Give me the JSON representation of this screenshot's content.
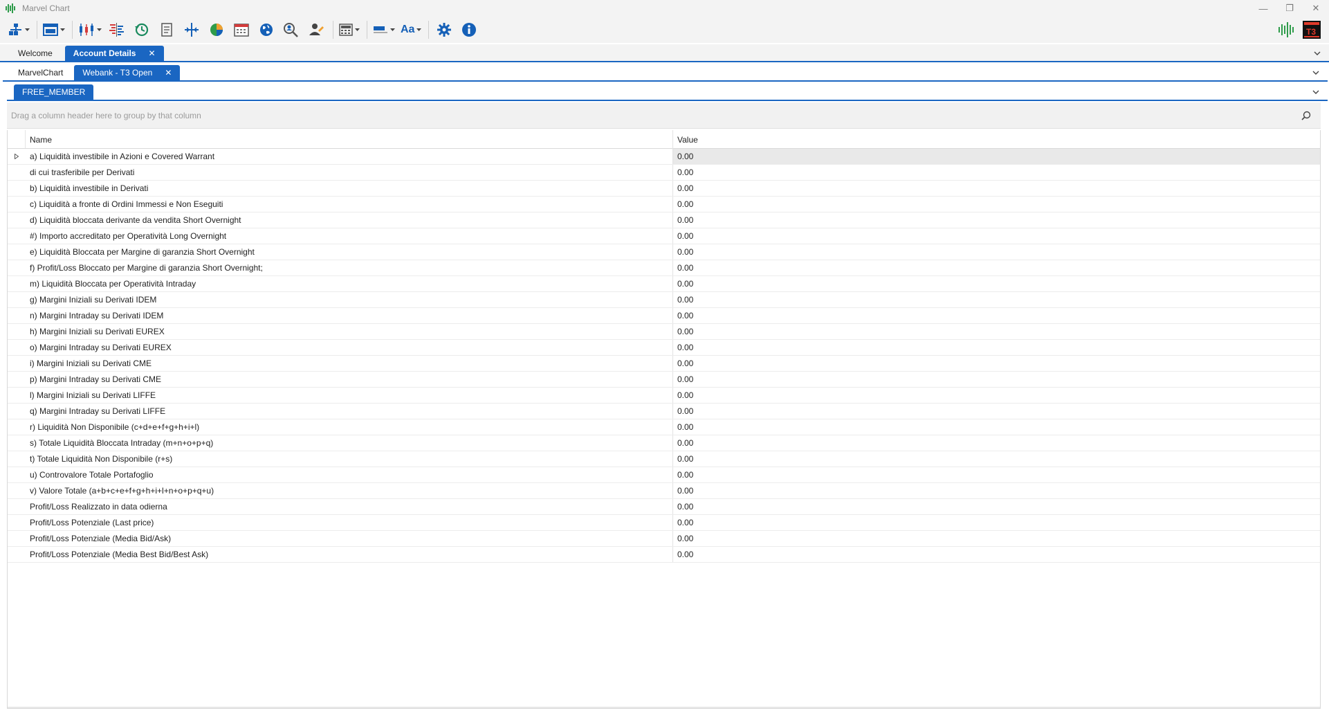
{
  "window": {
    "title": "Marvel Chart"
  },
  "colors": {
    "accent": "#1a66c2",
    "toolbar_icon": "#1560b7",
    "brand_green": "#2e9b4a",
    "selected_cell": "#e9e9e9"
  },
  "toolbar": {
    "items": [
      "workspace-layout-icon",
      "window-layout-icon",
      "candlestick-chart-icon",
      "depth-book-icon",
      "history-icon",
      "notes-icon",
      "crosshair-icon",
      "pie-chart-icon",
      "calendar-icon",
      "globe-icon",
      "search-person-icon",
      "user-pen-icon",
      "calculator-icon",
      "color-bar-icon",
      "font-size-icon",
      "settings-icon",
      "info-icon"
    ],
    "font_label": "Aa"
  },
  "tabs_level1": [
    {
      "label": "Welcome",
      "active": false
    },
    {
      "label": "Account Details",
      "active": true,
      "close": "✕"
    }
  ],
  "tabs_level2": [
    {
      "label": "MarvelChart",
      "active": false
    },
    {
      "label": "Webank - T3 Open",
      "active": true,
      "close": "✕"
    }
  ],
  "tabs_level3": [
    {
      "label": "FREE_MEMBER",
      "active": true
    }
  ],
  "group_panel": {
    "hint": "Drag a column header here to group by that column"
  },
  "grid": {
    "columns": [
      "Name",
      "Value"
    ],
    "rows": [
      {
        "name": "a) Liquidità investibile in Azioni e Covered Warrant",
        "value": "0.00"
      },
      {
        "name": "di cui trasferibile per Derivati",
        "value": "0.00"
      },
      {
        "name": "b) Liquidità investibile in Derivati",
        "value": "0.00"
      },
      {
        "name": "c) Liquidità a fronte di Ordini Immessi e Non Eseguiti",
        "value": "0.00"
      },
      {
        "name": "d) Liquidità bloccata derivante da vendita Short Overnight",
        "value": "0.00"
      },
      {
        "name": "#) Importo accreditato per Operatività Long Overnight",
        "value": "0.00"
      },
      {
        "name": "e) Liquidità Bloccata per Margine di garanzia Short Overnight",
        "value": "0.00"
      },
      {
        "name": "f) Profit/Loss Bloccato per Margine di garanzia Short Overnight;",
        "value": "0.00"
      },
      {
        "name": "m) Liquidità Bloccata per Operatività Intraday",
        "value": "0.00"
      },
      {
        "name": "g) Margini Iniziali su Derivati IDEM",
        "value": "0.00"
      },
      {
        "name": "n) Margini Intraday su Derivati IDEM",
        "value": "0.00"
      },
      {
        "name": "h) Margini Iniziali su Derivati EUREX",
        "value": "0.00"
      },
      {
        "name": "o) Margini Intraday su Derivati EUREX",
        "value": "0.00"
      },
      {
        "name": "i) Margini Iniziali su Derivati CME",
        "value": "0.00"
      },
      {
        "name": "p) Margini Intraday su Derivati CME",
        "value": "0.00"
      },
      {
        "name": "l) Margini Iniziali su Derivati LIFFE",
        "value": "0.00"
      },
      {
        "name": "q) Margini Intraday su Derivati LIFFE",
        "value": "0.00"
      },
      {
        "name": "r) Liquidità Non Disponibile (c+d+e+f+g+h+i+l)",
        "value": "0.00"
      },
      {
        "name": "s) Totale Liquidità Bloccata Intraday (m+n+o+p+q)",
        "value": "0.00"
      },
      {
        "name": "t) Totale Liquidità Non Disponibile (r+s)",
        "value": "0.00"
      },
      {
        "name": "u) Controvalore Totale Portafoglio",
        "value": "0.00"
      },
      {
        "name": "v) Valore Totale (a+b+c+e+f+g+h+i+l+n+o+p+q+u)",
        "value": "0.00"
      },
      {
        "name": "Profit/Loss Realizzato in data odierna",
        "value": "0.00"
      },
      {
        "name": "Profit/Loss Potenziale (Last price)",
        "value": "0.00"
      },
      {
        "name": "Profit/Loss Potenziale (Media Bid/Ask)",
        "value": "0.00"
      },
      {
        "name": "Profit/Loss Potenziale (Media Best Bid/Best Ask)",
        "value": "0.00"
      }
    ]
  }
}
